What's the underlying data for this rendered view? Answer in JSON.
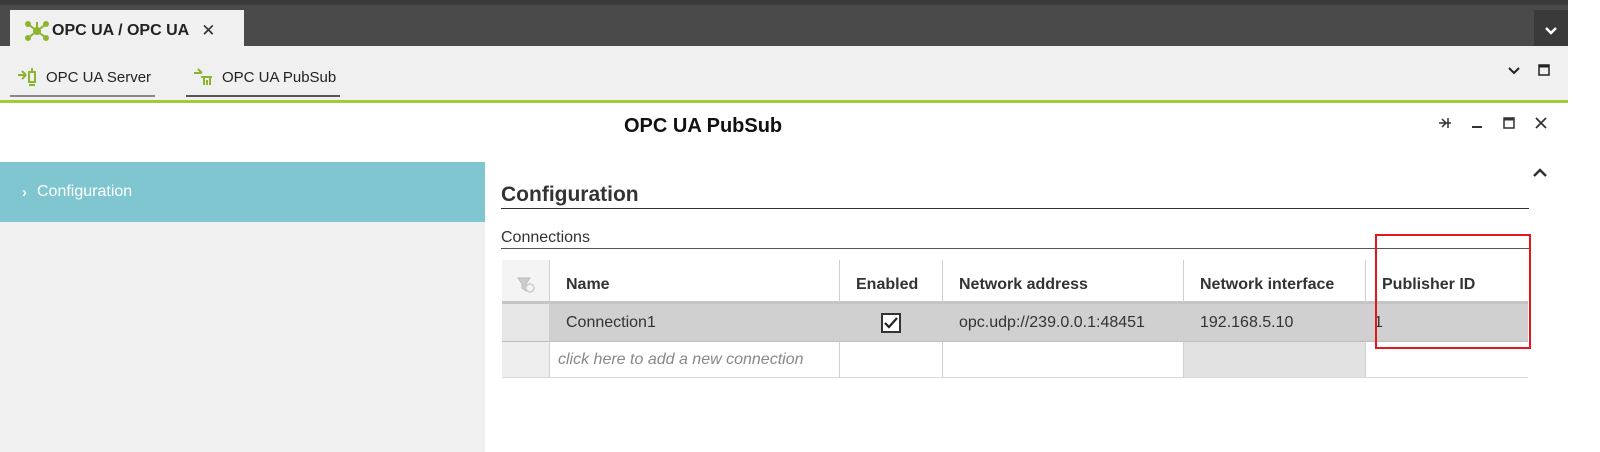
{
  "top_tab": {
    "label": "OPC UA / OPC UA",
    "close": "✕"
  },
  "sub_tabs": [
    {
      "label": "OPC UA Server"
    },
    {
      "label": "OPC UA PubSub"
    }
  ],
  "panel": {
    "title": "OPC UA PubSub"
  },
  "sidebar": {
    "items": [
      {
        "label": "Configuration"
      }
    ]
  },
  "section": {
    "title": "Configuration",
    "subtitle": "Connections"
  },
  "table": {
    "headers": [
      "Name",
      "Enabled",
      "Network address",
      "Network interface",
      "Publisher ID"
    ],
    "rows": [
      {
        "name": "Connection1",
        "enabled": true,
        "network_address": "opc.udp://239.0.0.1:48451",
        "network_interface": "192.168.5.10",
        "publisher_id": "1"
      }
    ],
    "add_placeholder": "click here to add a new connection"
  },
  "colors": {
    "accent": "#9fcc3a",
    "sidebar_active": "#7fc6d1",
    "highlight": "#e8161c"
  }
}
